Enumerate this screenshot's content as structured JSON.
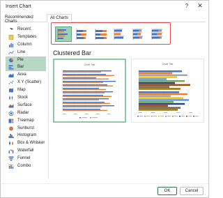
{
  "dialog": {
    "title": "Insert Chart",
    "help_glyph": "?",
    "close_glyph": "✕"
  },
  "tabs": [
    "Recommended Charts",
    "All Charts"
  ],
  "sidebar": {
    "items": [
      {
        "label": "Recent",
        "icon": "recent-icon"
      },
      {
        "label": "Templates",
        "icon": "templates-icon"
      },
      {
        "label": "Column",
        "icon": "column-chart-icon"
      },
      {
        "label": "Line",
        "icon": "line-chart-icon"
      },
      {
        "label": "Pie",
        "icon": "pie-chart-icon"
      },
      {
        "label": "Bar",
        "icon": "bar-chart-icon"
      },
      {
        "label": "Area",
        "icon": "area-chart-icon"
      },
      {
        "label": "X Y (Scatter)",
        "icon": "scatter-chart-icon"
      },
      {
        "label": "Map",
        "icon": "map-chart-icon"
      },
      {
        "label": "Stock",
        "icon": "stock-chart-icon"
      },
      {
        "label": "Surface",
        "icon": "surface-chart-icon"
      },
      {
        "label": "Radar",
        "icon": "radar-chart-icon"
      },
      {
        "label": "Treemap",
        "icon": "treemap-chart-icon"
      },
      {
        "label": "Sunburst",
        "icon": "sunburst-chart-icon"
      },
      {
        "label": "Histogram",
        "icon": "histogram-chart-icon"
      },
      {
        "label": "Box & Whisker",
        "icon": "box-whisker-chart-icon"
      },
      {
        "label": "Waterfall",
        "icon": "waterfall-chart-icon"
      },
      {
        "label": "Funnel",
        "icon": "funnel-chart-icon"
      },
      {
        "label": "Combo",
        "icon": "combo-chart-icon"
      }
    ],
    "highlighted": [
      "Pie",
      "Bar"
    ]
  },
  "subtypes": {
    "selected": "Clustered Bar",
    "icons": [
      "clustered-bar-icon",
      "stacked-bar-icon",
      "100-stacked-bar-icon",
      "3d-clustered-bar-icon",
      "3d-stacked-bar-icon",
      "3d-100-stacked-bar-icon"
    ]
  },
  "section_title": "Clustered Bar",
  "previews": [
    {
      "title": "Chart Title"
    },
    {
      "title": "Chart Title"
    }
  ],
  "footer": {
    "ok": "OK",
    "cancel": "Cancel"
  },
  "colors": {
    "accent": "#217346",
    "selected_bg": "#b8d8c6",
    "highlight_box": "#e24a4a",
    "series": [
      "#4472c4",
      "#ed7d31",
      "#a5a5a5",
      "#ffc000",
      "#5b9bd5",
      "#70ad47",
      "#264478",
      "#9e480e",
      "#636363",
      "#997300"
    ]
  }
}
